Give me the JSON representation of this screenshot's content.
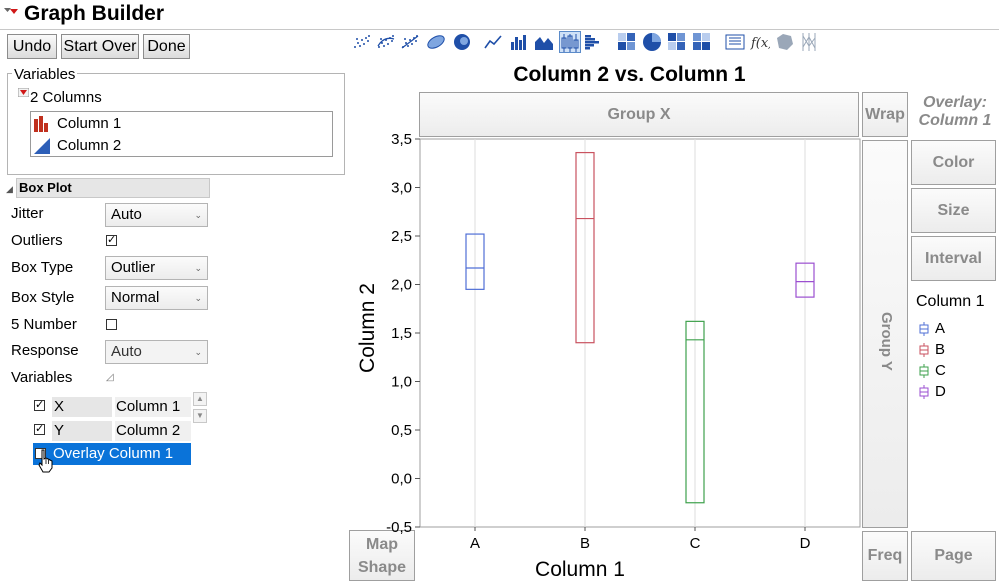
{
  "window": {
    "title": "Graph Builder"
  },
  "toolbar": {
    "undo": "Undo",
    "start_over": "Start Over",
    "done": "Done"
  },
  "element_icons": [
    "points-icon",
    "smoother-icon",
    "line-of-fit-icon",
    "ellipse-icon",
    "contour-icon",
    "line-icon",
    "bar-icon",
    "area-icon",
    "box-plot-icon",
    "histogram-icon",
    "heatmap-icon",
    "pie-icon",
    "treemap-icon",
    "mosaic-icon",
    "caption-box-icon",
    "formula-icon",
    "map-shapes-icon",
    "parallel-icon"
  ],
  "variables_panel": {
    "legend": "Variables",
    "root_label": "2 Columns",
    "columns": [
      {
        "name": "Column 1",
        "icon": "nominal-icon"
      },
      {
        "name": "Column 2",
        "icon": "continuous-icon"
      }
    ]
  },
  "box_plot": {
    "header": "Box Plot",
    "jitter_label": "Jitter",
    "jitter_value": "Auto",
    "outliers_label": "Outliers",
    "outliers_checked": true,
    "box_type_label": "Box Type",
    "box_type_value": "Outlier",
    "box_style_label": "Box Style",
    "box_style_value": "Normal",
    "five_number_label": "5 Number",
    "five_number_checked": false,
    "response_label": "Response",
    "response_value": "Auto",
    "variables_label": "Variables",
    "roles": [
      {
        "role": "X",
        "column": "Column 1",
        "checked": true
      },
      {
        "role": "Y",
        "column": "Column 2",
        "checked": true
      }
    ],
    "overlay_label": "Overlay Column 1",
    "overlay_checked": true
  },
  "graph": {
    "title": "Column 2 vs. Column 1",
    "zones": {
      "group_x": "Group X",
      "group_y": "Group Y",
      "wrap": "Wrap",
      "overlay_line1": "Overlay:",
      "overlay_line2": "Column 1",
      "color": "Color",
      "size": "Size",
      "interval": "Interval",
      "map_shape_line1": "Map",
      "map_shape_line2": "Shape",
      "freq": "Freq",
      "page": "Page"
    }
  },
  "chart_data": {
    "type": "box",
    "title": "Column 2 vs. Column 1",
    "xlabel": "Column 1",
    "ylabel": "Column 2",
    "categories": [
      "A",
      "B",
      "C",
      "D"
    ],
    "ylim": [
      -0.5,
      3.5
    ],
    "yticks": [
      "-0,5",
      "0,0",
      "0,5",
      "1,0",
      "1,5",
      "2,0",
      "2,5",
      "3,0",
      "3,5"
    ],
    "ytick_values": [
      -0.5,
      0,
      0.5,
      1,
      1.5,
      2,
      2.5,
      3,
      3.5
    ],
    "grid": "vertical",
    "boxes": [
      {
        "category": "A",
        "q1": 1.95,
        "median": 2.17,
        "q3": 2.52,
        "color": "#4f6fd6"
      },
      {
        "category": "B",
        "q1": 1.4,
        "median": 2.68,
        "q3": 3.36,
        "color": "#c9525f"
      },
      {
        "category": "C",
        "q1": -0.25,
        "median": 1.43,
        "q3": 1.62,
        "color": "#3ea14c"
      },
      {
        "category": "D",
        "q1": 1.87,
        "median": 2.03,
        "q3": 2.22,
        "color": "#9b4fd0"
      }
    ],
    "legend": {
      "title": "Column 1",
      "position": "right",
      "entries": [
        "A",
        "B",
        "C",
        "D"
      ]
    }
  }
}
